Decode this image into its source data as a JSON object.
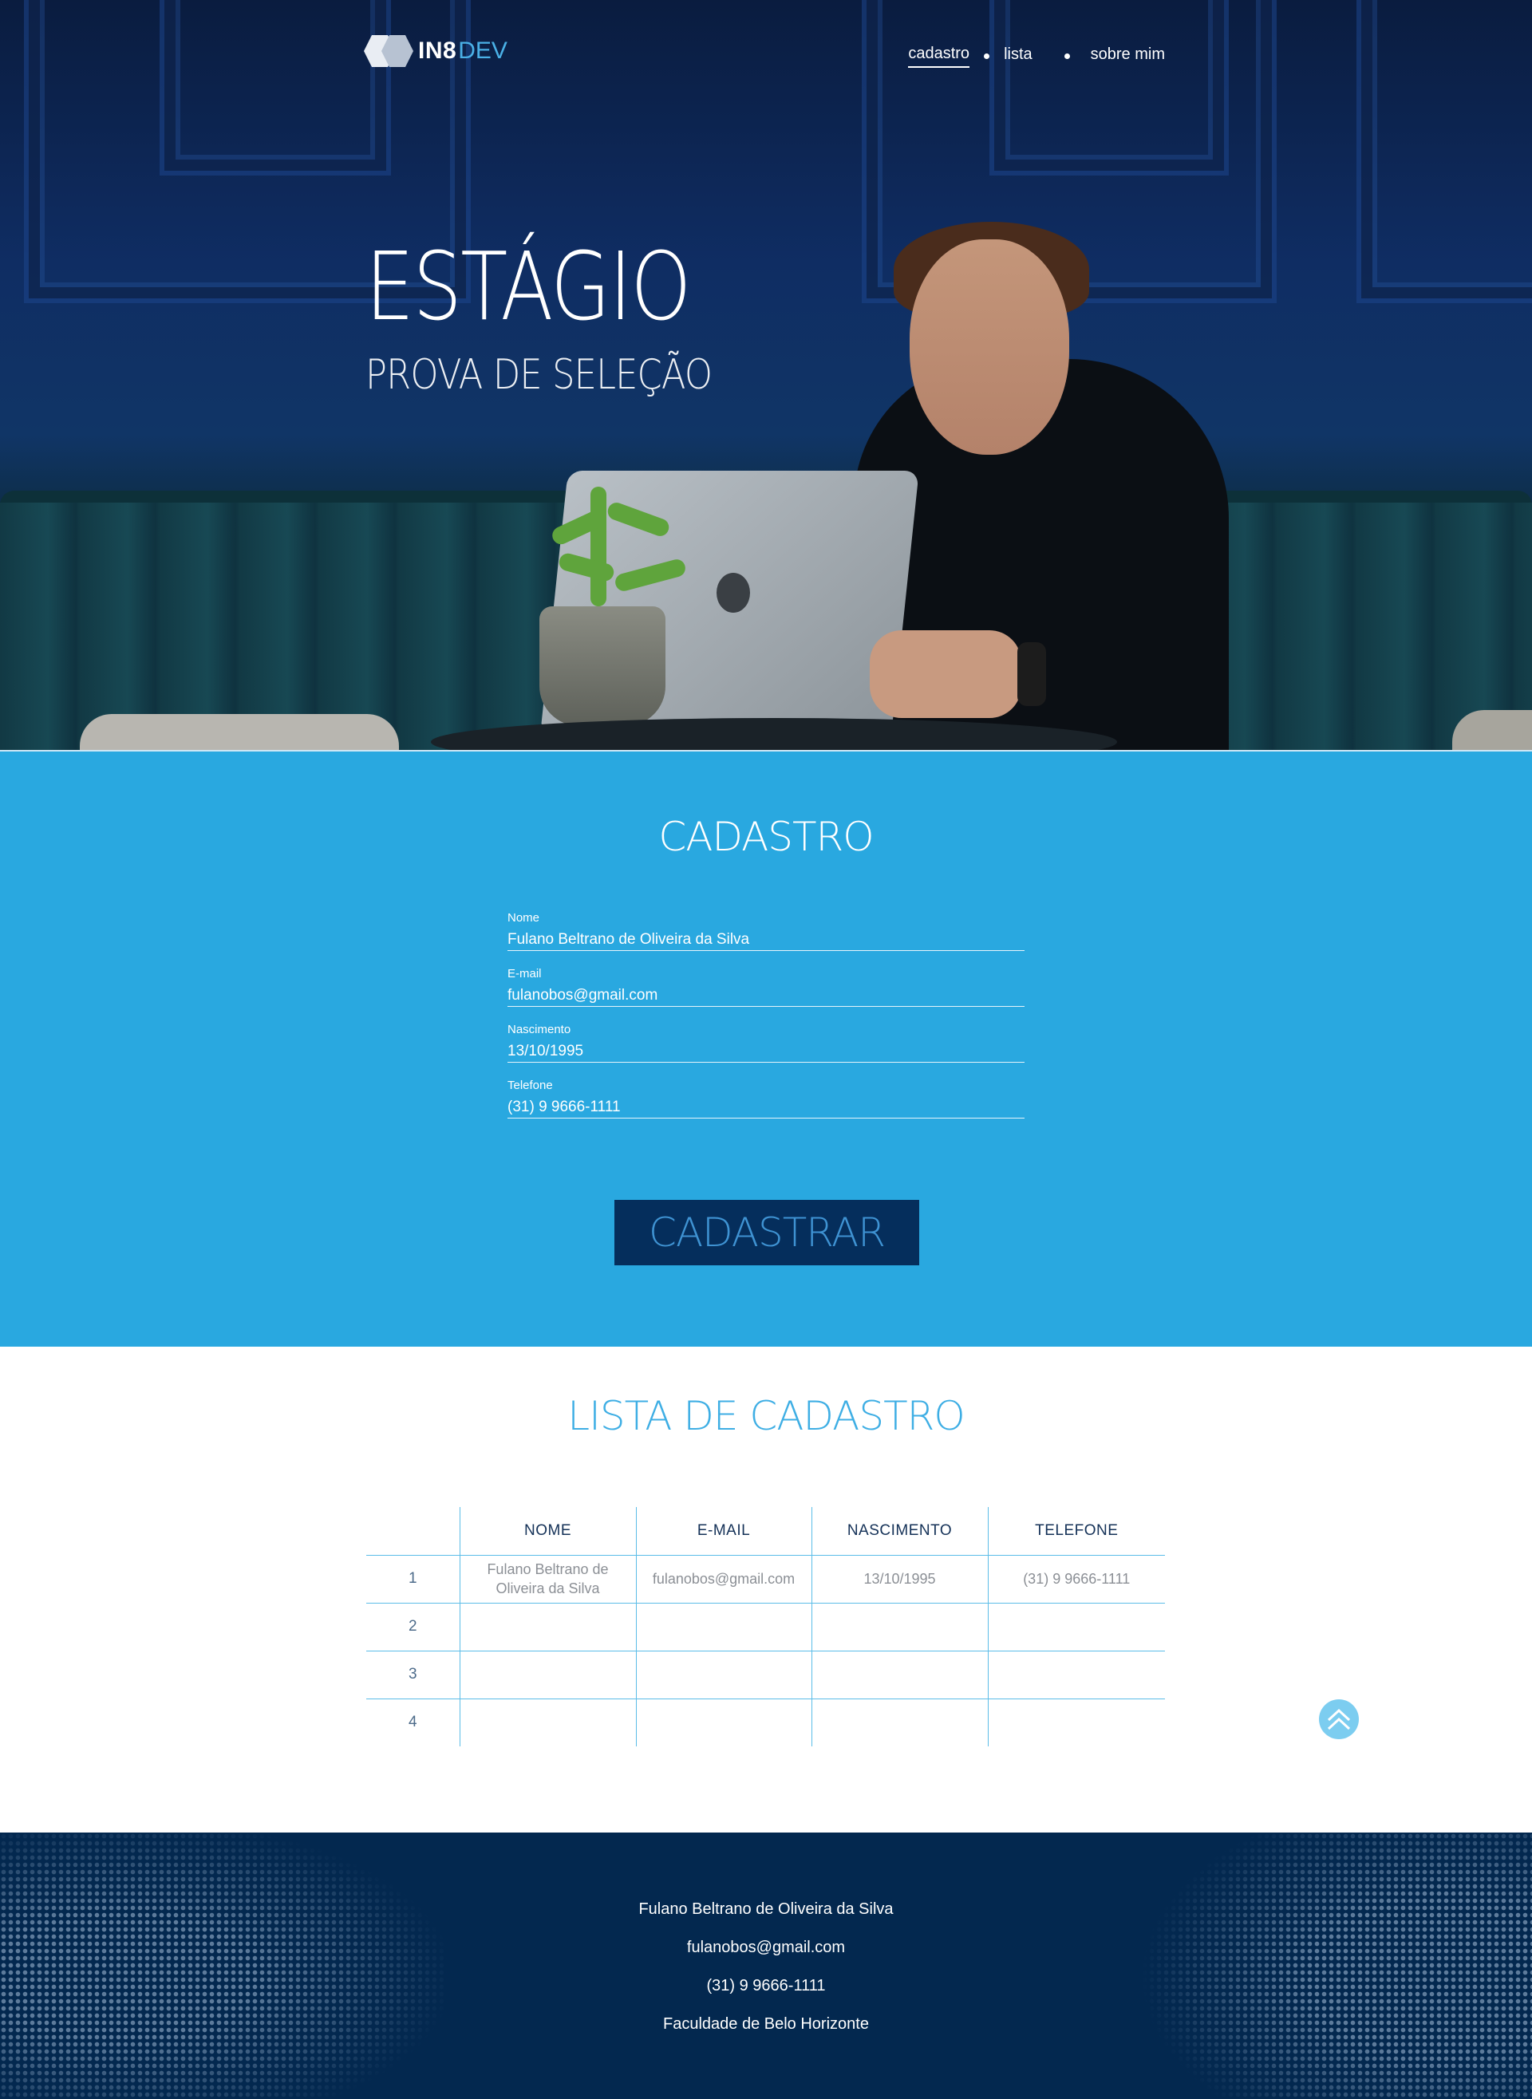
{
  "header": {
    "logo_bold": "IN8",
    "logo_light": "DEV",
    "nav": [
      "cadastro",
      "lista",
      "sobre mim"
    ]
  },
  "hero": {
    "title": "ESTÁGIO",
    "subtitle": "PROVA DE SELEÇÃO"
  },
  "cadastro": {
    "title": "CADASTRO",
    "fields": [
      {
        "label": "Nome",
        "value": "Fulano Beltrano de Oliveira da Silva"
      },
      {
        "label": "E-mail",
        "value": "fulanobos@gmail.com"
      },
      {
        "label": "Nascimento",
        "value": "13/10/1995"
      },
      {
        "label": "Telefone",
        "value": "(31) 9 9666-1111"
      }
    ],
    "button": "CADASTRAR"
  },
  "lista": {
    "title": "LISTA DE CADASTRO",
    "headers": [
      "",
      "NOME",
      "E-MAIL",
      "NASCIMENTO",
      "TELEFONE"
    ],
    "rows": [
      [
        "1",
        "Fulano Beltrano de Oliveira da Silva",
        "fulanobos@gmail.com",
        "13/10/1995",
        "(31) 9 9666-1111"
      ],
      [
        "2",
        "",
        "",
        "",
        ""
      ],
      [
        "3",
        "",
        "",
        "",
        ""
      ],
      [
        "4",
        "",
        "",
        "",
        ""
      ]
    ],
    "back_to_top_icon": "chevron-up-double-icon"
  },
  "footer": {
    "lines": [
      "Fulano Beltrano de Oliveira da Silva",
      "fulanobos@gmail.com",
      "(31) 9 9666-1111",
      "Faculdade de Belo Horizonte"
    ]
  },
  "colors": {
    "hero_dark": "#0f2d63",
    "cadastro_bg": "#29a8e0",
    "button_bg": "#052e5c",
    "accent": "#3eaee4",
    "footer_bg": "#03284f"
  }
}
